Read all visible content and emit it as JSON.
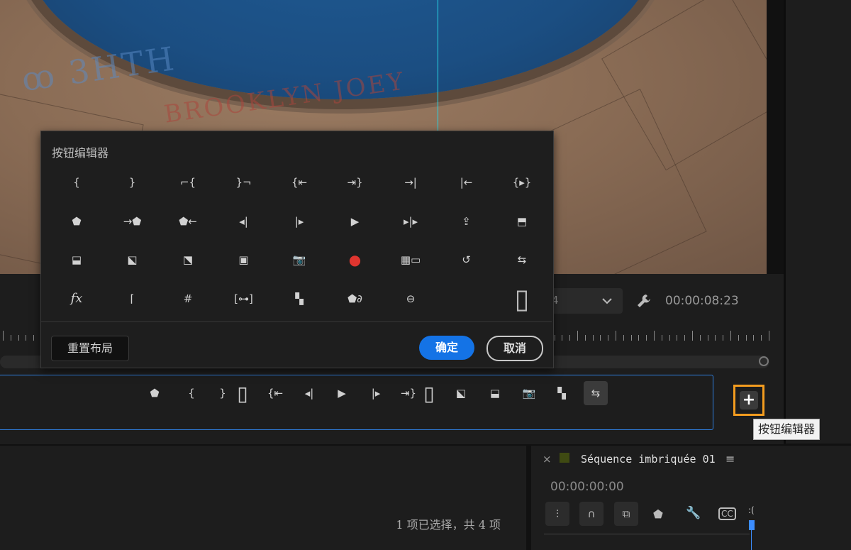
{
  "monitor": {
    "timecode": "00:00:08:23",
    "dropdown_value": "4",
    "graffiti_text": "BROOKLYN JOEY"
  },
  "dialog": {
    "title": "按钮编辑器",
    "reset_label": "重置布局",
    "ok_label": "确定",
    "cancel_label": "取消",
    "icons": [
      "mark-in-icon",
      "mark-out-icon",
      "clear-in-icon",
      "clear-out-icon",
      "go-to-in-icon",
      "go-to-out-icon",
      "step-forward-edit-icon",
      "step-back-edit-icon",
      "play-in-to-out-icon",
      "add-marker-icon",
      "go-to-next-marker-icon",
      "go-to-previous-marker-icon",
      "step-back-icon",
      "step-forward-icon",
      "play-icon",
      "play-around-icon",
      "export-frame-icon",
      "overwrite-icon",
      "extract-icon",
      "lift-icon",
      "trim-icon",
      "safe-margins-icon",
      "camera-icon",
      "record-icon",
      "multi-camera-icon",
      "loop-icon",
      "comparison-view-icon",
      "fx-icon",
      "output-icon",
      "grid-icon",
      "transmit-icon",
      "proxy-toggle-icon",
      "marker-link-icon",
      "vr-video-icon",
      "blank-space-icon",
      "spacer-icon"
    ]
  },
  "button_bar": {
    "icons": [
      "add-marker-icon",
      "mark-in-icon",
      "mark-out-icon",
      "spacer-icon",
      "go-to-in-icon",
      "step-back-icon",
      "play-icon",
      "step-forward-icon",
      "go-to-out-icon",
      "spacer-icon",
      "lift-icon",
      "extract-icon",
      "camera-icon",
      "proxy-toggle-icon",
      "comparison-view-icon"
    ]
  },
  "plus_button": {
    "icon": "plus-icon",
    "tooltip": "按钮编辑器"
  },
  "project_panel": {
    "selection_status": "1 项已选择，共 4 项"
  },
  "sequence_panel": {
    "title": "Séquence imbriquée 01",
    "timecode": "00:00:00:00",
    "partial_label": ":("
  }
}
